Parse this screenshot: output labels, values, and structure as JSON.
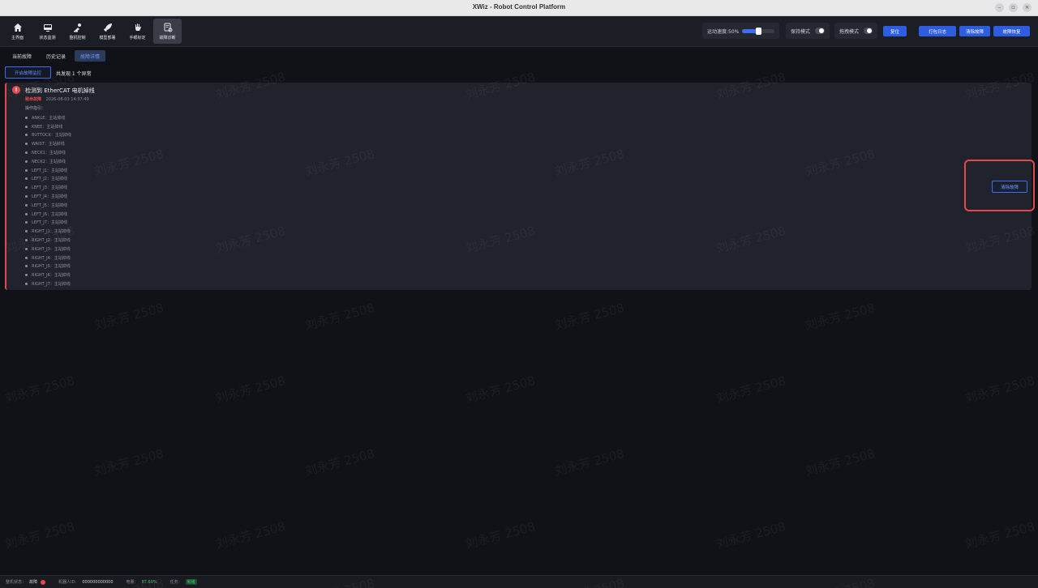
{
  "window": {
    "title": "XWiz - Robot Control Platform",
    "buttons": [
      "–",
      "▫",
      "×"
    ]
  },
  "nav": {
    "items": [
      {
        "label": "主界面",
        "icon": "home-icon"
      },
      {
        "label": "状态监测",
        "icon": "monitor-icon"
      },
      {
        "label": "整机控制",
        "icon": "robot-control-icon"
      },
      {
        "label": "模型部署",
        "icon": "rocket-icon"
      },
      {
        "label": "手眼标定",
        "icon": "hand-icon"
      },
      {
        "label": "故障诊断",
        "icon": "diagnosis-icon",
        "active": true
      }
    ]
  },
  "controls": {
    "speed_label": "运动速度:50%",
    "speed_fraction": 0.5,
    "hold_mode_label": "保持模式",
    "drag_mode_label": "拖拽模式",
    "reset_label": "复位",
    "log_label": "打包日志",
    "clear_fault_label": "清除故障",
    "fault_reset_label": "故障恢复"
  },
  "tabs": [
    {
      "label": "当前故障"
    },
    {
      "label": "历史记录"
    },
    {
      "label": "故障详情",
      "active": true
    }
  ],
  "monitor_button": "开启故障监控",
  "found_text": "共发现 1 个异常",
  "fault": {
    "title": "检测到 EtherCAT 电机掉线",
    "severity": "致命故障",
    "time": "2026-08-03 14:37:49",
    "guide_title": "操作指引：",
    "joints": [
      "ANKLE：主站掉线",
      "KNEE：主站掉线",
      "BUTTOCK：主站掉线",
      "WAIST：主站掉线",
      "NECK1：主站掉线",
      "NECK2：主站掉线",
      "LEFT_J1：主站掉线",
      "LEFT_J2：主站掉线",
      "LEFT_J3：主站掉线",
      "LEFT_J4：主站掉线",
      "LEFT_J5：主站掉线",
      "LEFT_J6：主站掉线",
      "LEFT_J7：主站掉线",
      "RIGHT_J1：主站掉线",
      "RIGHT_J2：主站掉线",
      "RIGHT_J3：主站掉线",
      "RIGHT_J4：主站掉线",
      "RIGHT_J5：主站掉线",
      "RIGHT_J6：主站掉线",
      "RIGHT_J7：主站掉线"
    ],
    "clear_button": "清除故障"
  },
  "status": {
    "state_label": "整机状态：",
    "state_value": "故障",
    "robot_id_label": "机器人ID：",
    "robot_id_value": "000000000000",
    "battery_label": "电量：",
    "battery_value": "87.60%",
    "task_label": "任务：",
    "task_value": "就绪"
  },
  "watermark": "刘永芳 2508",
  "colors": {
    "accent": "#3d6df2",
    "danger": "#e5484d",
    "success": "#3ec46d"
  }
}
